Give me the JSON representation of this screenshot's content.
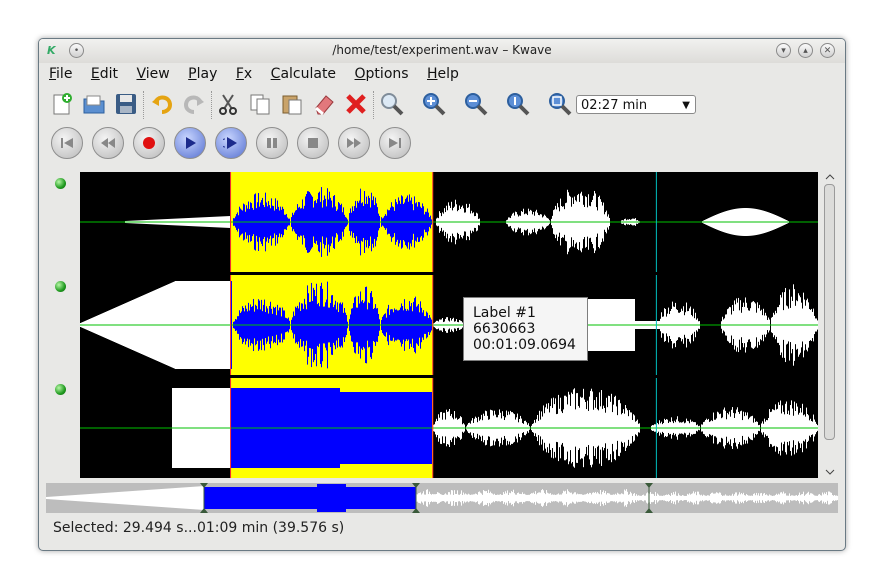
{
  "window": {
    "title": "/home/test/experiment.wav – Kwave",
    "logo": "K"
  },
  "menu": [
    {
      "label": "File",
      "key": "F",
      "rest": "ile"
    },
    {
      "label": "Edit",
      "key": "E",
      "rest": "dit"
    },
    {
      "label": "View",
      "key": "V",
      "rest": "iew"
    },
    {
      "label": "Play",
      "key": "P",
      "rest": "lay"
    },
    {
      "label": "Fx",
      "key": "F",
      "rest": "x"
    },
    {
      "label": "Calculate",
      "key": "C",
      "rest": "alculate"
    },
    {
      "label": "Options",
      "key": "O",
      "rest": "ptions"
    },
    {
      "label": "Help",
      "key": "H",
      "rest": "elp"
    }
  ],
  "toolbar": {
    "icons": [
      "new-file-icon",
      "open-file-icon",
      "save-icon",
      "undo-icon",
      "redo-icon",
      "cut-icon",
      "copy-icon",
      "paste-icon",
      "erase-icon",
      "delete-icon",
      "zoom-selection-icon",
      "zoom-in-icon",
      "zoom-out-icon",
      "zoom-normal-icon",
      "zoom-all-icon"
    ],
    "zoom_value": "02:27 min"
  },
  "playback": {
    "icons": [
      "skip-start-icon",
      "rewind-icon",
      "record-icon",
      "play-icon",
      "loop-play-icon",
      "pause-icon",
      "stop-icon",
      "forward-icon",
      "skip-end-icon"
    ]
  },
  "tooltip": {
    "line1": "Label #1",
    "line2": "6630663",
    "line3": "00:01:09.0694"
  },
  "status": {
    "text": "Selected: 29.494 s...01:09 min (39.576 s)"
  },
  "colors": {
    "selection_bg": "#ffff00",
    "selected_wave": "#0000ff",
    "wave": "#ffffff",
    "background": "#000000",
    "zero_line": "#00c000",
    "label_marker": "#00bfbf",
    "led": "#1f9a1f"
  },
  "selection": {
    "start_fraction": 0.204,
    "end_fraction": 0.478
  },
  "label_marker_fraction": 0.781
}
